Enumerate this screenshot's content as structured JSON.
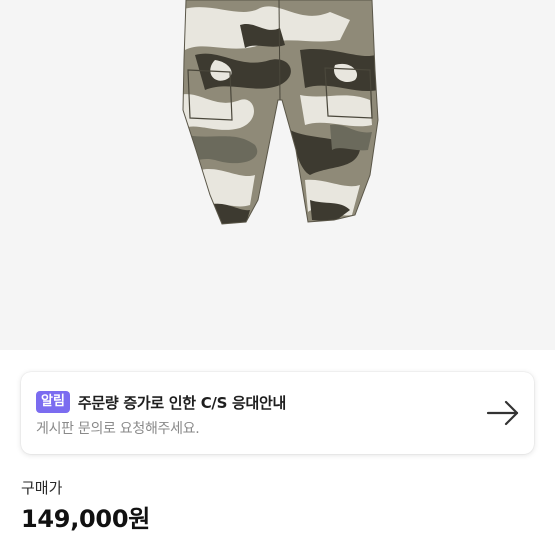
{
  "product": {
    "image_alt": "camouflage cargo pants"
  },
  "notice": {
    "badge": "알림",
    "title": "주문량 증가로 인한 C/S 응대안내",
    "subtitle": "게시판 문의로 요청해주세요.",
    "arrow_icon": "arrow-right-icon"
  },
  "price": {
    "label": "구매가",
    "value": "149,000원"
  },
  "colors": {
    "badge": "#7b6cf0",
    "image_background": "#f5f5f5",
    "camo_base": "#8f8a78",
    "camo_dark": "#3d3a30",
    "camo_light": "#e8e6de",
    "camo_mid": "#6b6a5c"
  }
}
